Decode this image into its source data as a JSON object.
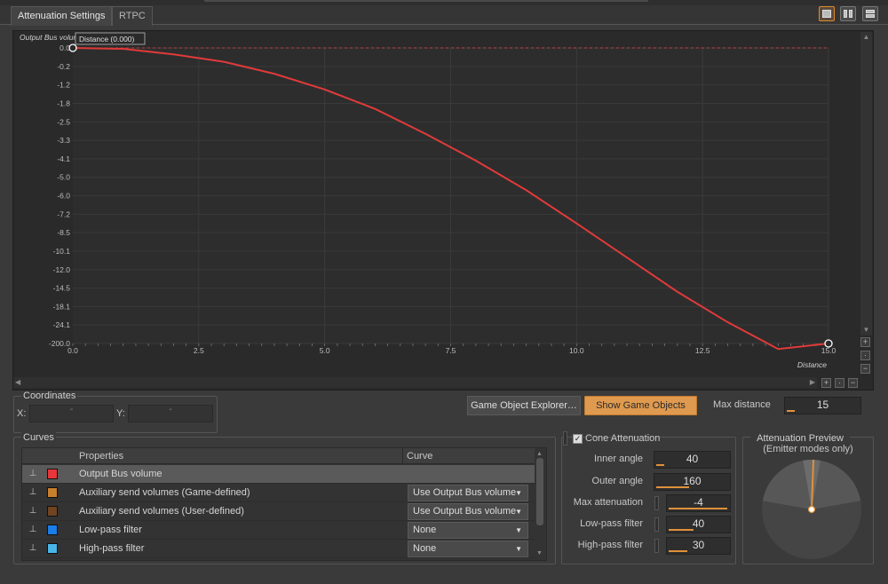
{
  "tabs": [
    {
      "label": "Attenuation Settings",
      "active": true
    },
    {
      "label": "RTPC",
      "active": false
    }
  ],
  "graph": {
    "series_name": "Output Bus volume",
    "tooltip": "Distance (0.000)",
    "x_axis_label": "Distance",
    "x_ticks": [
      "0.0",
      "2.5",
      "5.0",
      "7.5",
      "10.0",
      "12.5",
      "15.0"
    ],
    "y_ticks": [
      "0.0",
      "-0.2",
      "-1.2",
      "-1.8",
      "-2.5",
      "-3.3",
      "-4.1",
      "-5.0",
      "-6.0",
      "-7.2",
      "-8.5",
      "-10.1",
      "-12.0",
      "-14.5",
      "-18.1",
      "-24.1",
      "-200.0"
    ],
    "colors": {
      "curve": "#e03a3a",
      "grid": "#3a3a3a",
      "point": "#ffffff"
    }
  },
  "chart_data": {
    "type": "line",
    "xlabel": "Distance",
    "ylabel": "Output Bus volume",
    "xlim": [
      0,
      15
    ],
    "ylim": [
      -200,
      0
    ],
    "y_scale": "custom (tick spacing non-linear)",
    "grid": true,
    "series": [
      {
        "name": "Output Bus volume",
        "x": [
          0,
          1,
          2,
          3,
          4,
          5,
          6,
          7,
          8,
          9,
          10,
          11,
          12,
          13,
          14,
          15
        ],
        "y": [
          0.0,
          -0.1,
          -0.3,
          -0.6,
          -1.0,
          -1.5,
          -2.2,
          -3.0,
          -3.9,
          -5.0,
          -6.2,
          -7.8,
          -9.8,
          -12.8,
          -18.0,
          -200.0
        ],
        "y_tick_position": [
          0.0,
          0.05,
          0.35,
          0.75,
          1.4,
          2.25,
          3.3,
          4.65,
          6.1,
          7.7,
          9.5,
          11.35,
          13.2,
          14.85,
          16.3,
          16.0
        ]
      }
    ]
  },
  "coordinates": {
    "title": "Coordinates",
    "x_label": "X:",
    "y_label": "Y:",
    "x_value": "-",
    "y_value": "-"
  },
  "buttons": {
    "explorer": "Game Object Explorer…",
    "show_objects": "Show Game Objects"
  },
  "max_distance": {
    "label": "Max distance",
    "value": "15",
    "fraction": 0.11
  },
  "curves": {
    "title": "Curves",
    "columns": [
      "Properties",
      "Curve"
    ],
    "rows": [
      {
        "name": "Output Bus volume",
        "color": "#e8363b",
        "curve": "",
        "selected": true
      },
      {
        "name": "Auxiliary send volumes (Game-defined)",
        "color": "#c9802d",
        "curve": "Use Output Bus volume",
        "selected": false
      },
      {
        "name": "Auxiliary send volumes (User-defined)",
        "color": "#6e4421",
        "curve": "Use Output Bus volume",
        "selected": false
      },
      {
        "name": "Low-pass filter",
        "color": "#1b7de8",
        "curve": "None",
        "selected": false
      },
      {
        "name": "High-pass filter",
        "color": "#49b6e8",
        "curve": "None",
        "selected": false
      }
    ]
  },
  "cone": {
    "title": "Cone Attenuation",
    "checked": true,
    "fields": [
      {
        "label": "Inner angle",
        "value": "40",
        "fraction": 0.11
      },
      {
        "label": "Outer angle",
        "value": "160",
        "fraction": 0.44
      },
      {
        "label": "Max attenuation",
        "value": "-4",
        "fraction": 0.96
      },
      {
        "label": "Low-pass filter",
        "value": "40",
        "fraction": 0.4
      },
      {
        "label": "High-pass filter",
        "value": "30",
        "fraction": 0.3
      }
    ]
  },
  "preview": {
    "title_line1": "Attenuation Preview",
    "title_line2": "(Emitter modes only)",
    "inner_angle": 40,
    "outer_angle": 160
  }
}
